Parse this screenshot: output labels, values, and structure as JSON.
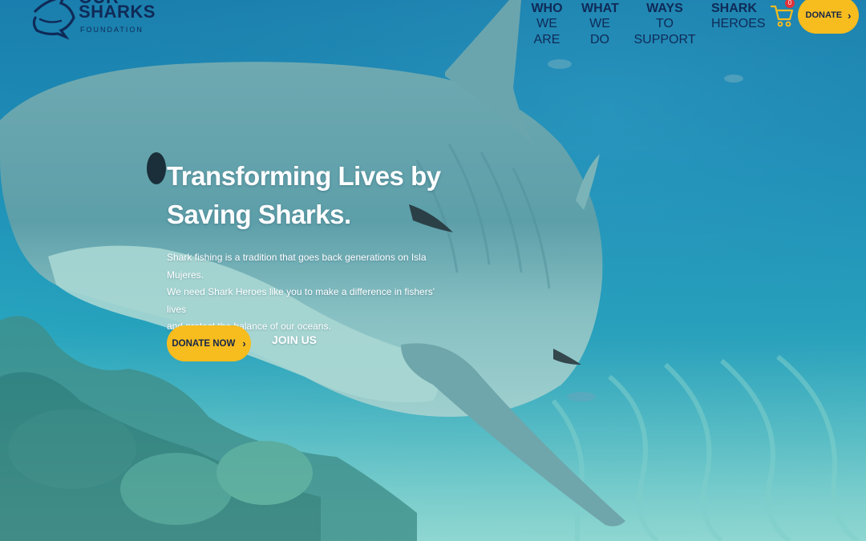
{
  "logo": {
    "line1": "OUR",
    "line2": "SHARKS",
    "line3": "FOUNDATION"
  },
  "nav": {
    "items": [
      {
        "top": "WHO",
        "bottom": "WE ARE"
      },
      {
        "top": "WHAT",
        "bottom": "WE DO"
      },
      {
        "top": "WAYS",
        "bottom": "TO SUPPORT"
      },
      {
        "top": "SHARK",
        "bottom": "HEROES"
      }
    ],
    "cart_count": "0",
    "donate_label": "DONATE",
    "chevron": "›"
  },
  "hero": {
    "headline_line1": "Transforming Lives by",
    "headline_line2": "Saving Sharks.",
    "body_line1": "Shark fishing is a tradition that goes back generations on Isla Mujeres.",
    "body_line2": "We need Shark Heroes like you to make a difference in fishers' lives",
    "body_line3": "and protect the balance of our oceans.",
    "donate_now_label": "DONATE NOW",
    "join_label": "JOIN US"
  },
  "colors": {
    "accent_yellow": "#f7bc1e",
    "navy": "#0f2a57",
    "ocean": "#1e8fb8"
  },
  "icons": [
    "shark-logo-icon",
    "cart-icon",
    "chevron-right-icon"
  ]
}
